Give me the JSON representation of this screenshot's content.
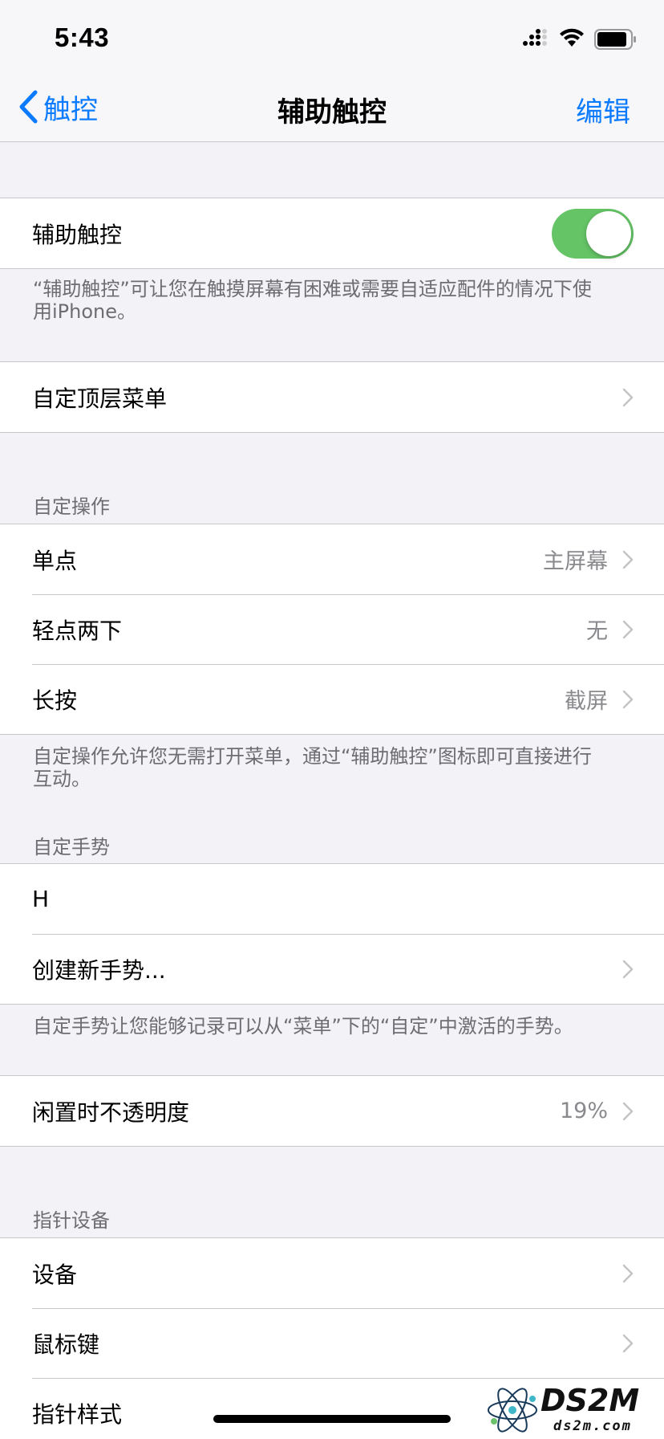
{
  "status": {
    "time": "5:43"
  },
  "nav": {
    "back_label": "触控",
    "title": "辅助触控",
    "edit_label": "编辑"
  },
  "assistive_touch": {
    "label": "辅助触控",
    "enabled": true,
    "footer": "“辅助触控”可让您在触摸屏幕有困难或需要自适应配件的情况下使用iPhone。"
  },
  "top_menu": {
    "label": "自定顶层菜单"
  },
  "custom_actions": {
    "header": "自定操作",
    "items": [
      {
        "label": "单点",
        "value": "主屏幕"
      },
      {
        "label": "轻点两下",
        "value": "无"
      },
      {
        "label": "长按",
        "value": "截屏"
      }
    ],
    "footer": "自定操作允许您无需打开菜单，通过“辅助触控”图标即可直接进行互动。"
  },
  "custom_gestures": {
    "header": "自定手势",
    "items": [
      {
        "label": "H"
      },
      {
        "label": "创建新手势..."
      }
    ],
    "footer": "自定手势让您能够记录可以从“菜单”下的“自定”中激活的手势。"
  },
  "idle_opacity": {
    "label": "闲置时不透明度",
    "value": "19%"
  },
  "pointer_devices": {
    "header": "指针设备",
    "items": [
      {
        "label": "设备"
      },
      {
        "label": "鼠标键"
      },
      {
        "label": "指针样式"
      }
    ]
  },
  "watermark": {
    "text": "DS2M",
    "sub": "ds2m.com"
  },
  "colors": {
    "accent": "#0a7aff",
    "toggle_on": "#65c466",
    "background": "#f2f2f7"
  }
}
